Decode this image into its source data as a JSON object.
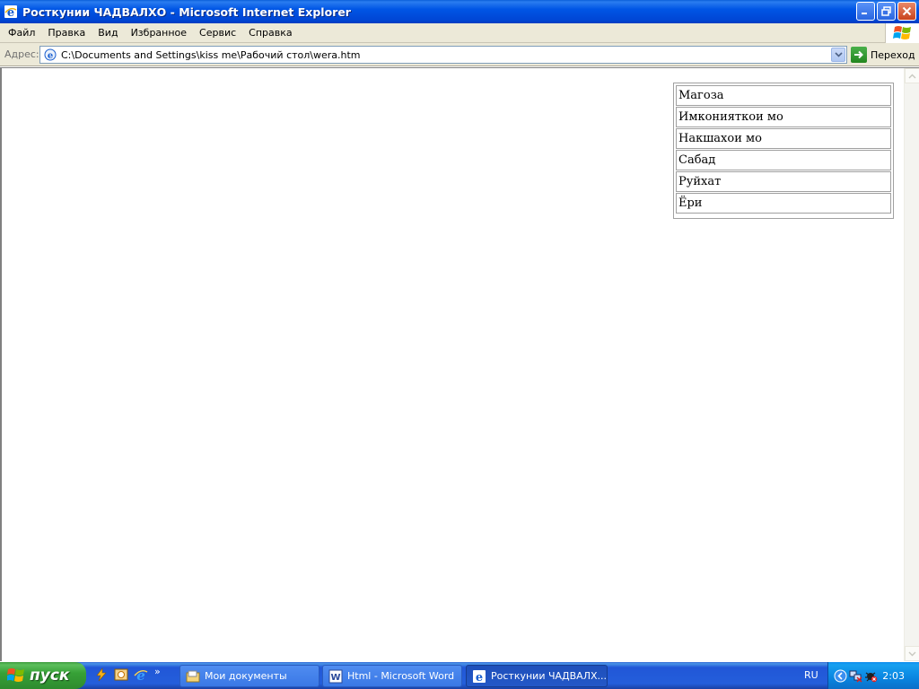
{
  "window": {
    "title": "Росткунии ЧАДВАЛХО - Microsoft Internet Explorer",
    "icon": "ie-icon"
  },
  "menubar": {
    "items": [
      "Файл",
      "Правка",
      "Вид",
      "Избранное",
      "Сервис",
      "Справка"
    ]
  },
  "address": {
    "label": "Адрес:",
    "value": "C:\\Documents and Settings\\kiss me\\Рабочий стол\\wera.htm",
    "go_label": "Переход"
  },
  "page": {
    "nav_items": [
      "Магоза",
      "Имконияткои мо",
      "Накшахои мо",
      "Сабад",
      "Руйхат",
      "Ёри"
    ]
  },
  "taskbar": {
    "start_label": "пуск",
    "tasks": [
      {
        "label": "Мои документы",
        "icon": "folder-icon"
      },
      {
        "label": "Html - Microsoft Word",
        "icon": "word-icon"
      },
      {
        "label": "Росткунии ЧАДВАЛХ...",
        "icon": "ie-icon"
      }
    ],
    "language": "RU",
    "clock": "2:03"
  },
  "colors": {
    "titlebar": "#0055e5",
    "taskbar": "#245edb",
    "start": "#37a137",
    "menu_bg": "#ece9d8"
  }
}
